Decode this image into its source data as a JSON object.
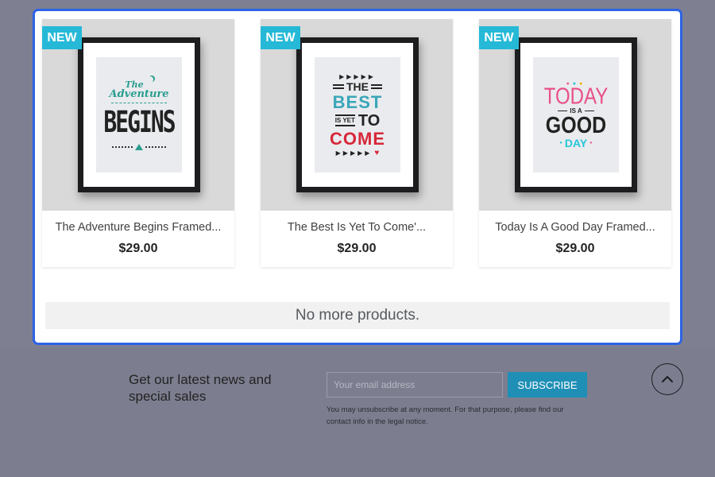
{
  "products": [
    {
      "badge": "NEW",
      "title": "The Adventure Begins Framed...",
      "price": "$29.00",
      "art": {
        "line1": "The",
        "line2": "Adventure",
        "line3": "BEGINS"
      }
    },
    {
      "badge": "NEW",
      "title": "The Best Is Yet To Come'...",
      "price": "$29.00",
      "art": {
        "line1": "THE",
        "line2": "BEST",
        "line3": "IS YET",
        "line4": "TO",
        "line5": "COME"
      }
    },
    {
      "badge": "NEW",
      "title": "Today Is A Good Day Framed...",
      "price": "$29.00",
      "art": {
        "line1": "TODAY",
        "line2": "IS A",
        "line3": "GOOD",
        "line4": "DAY"
      }
    }
  ],
  "no_more_text": "No more products.",
  "newsletter": {
    "heading": "Get our latest news and special sales",
    "email_placeholder": "Your email address",
    "subscribe_label": "SUBSCRIBE",
    "legal_note": "You may unsubscribe at any moment. For that purpose, please find our contact info in the legal notice."
  },
  "icons": {
    "scroll_top": "chevron-up-icon"
  },
  "colors": {
    "modal_border": "#2e63e6",
    "badge": "#25b9d7",
    "subscribe": "#1f8fb6",
    "page_background": "#7c7e8f"
  }
}
